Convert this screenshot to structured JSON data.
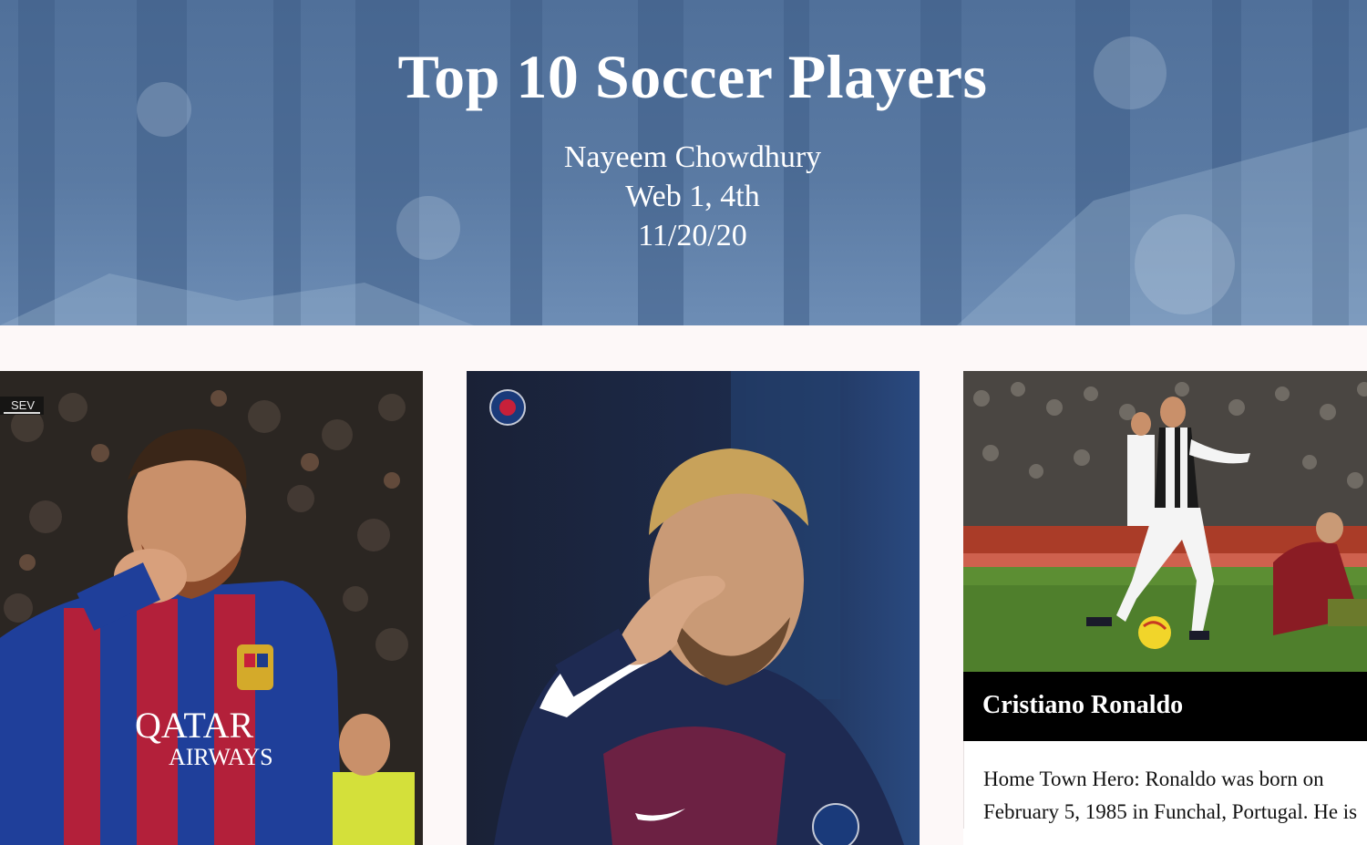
{
  "header": {
    "title": "Top 10 Soccer Players",
    "author": "Nayeem Chowdhury",
    "class": "Web 1, 4th",
    "date": "11/20/20"
  },
  "cards": [
    {
      "image": "messi-photo",
      "badge": "SEV",
      "jersey_text_1": "QATAR",
      "jersey_text_2": "AIRWAYS"
    },
    {
      "image": "neymar-photo"
    },
    {
      "image": "ronaldo-photo",
      "name": "Cristiano Ronaldo",
      "desc_line_1": "Home Town Hero: Ronaldo was born on",
      "desc_line_2": "February 5, 1985 in Funchal, Portugal. He is"
    }
  ],
  "colors": {
    "hero_blue": "#5a7aa3",
    "page_bg": "#fdf8f8",
    "name_bar": "#000000"
  }
}
